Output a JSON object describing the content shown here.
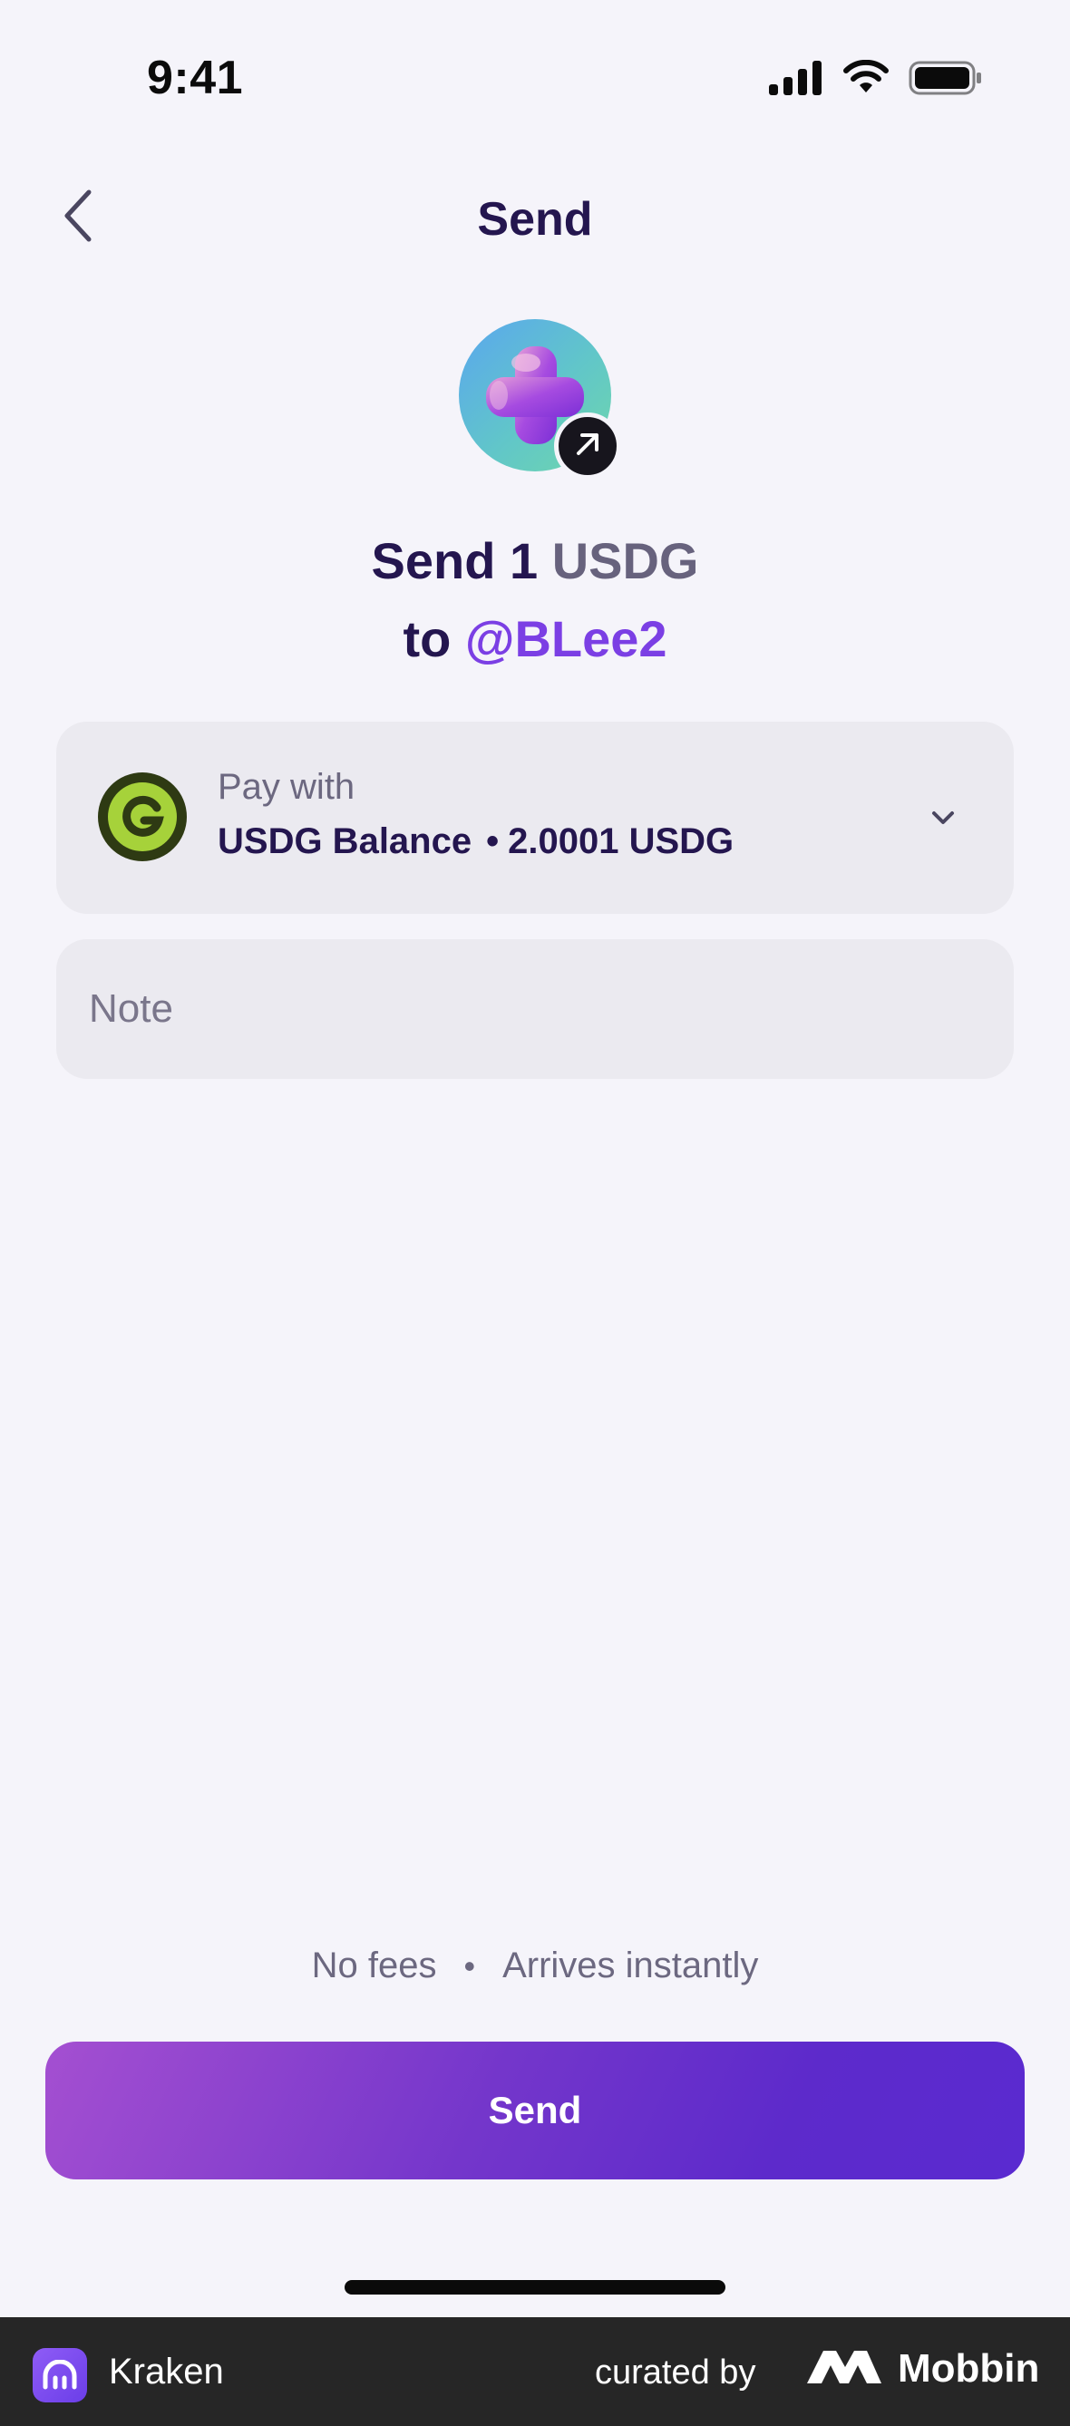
{
  "status_bar": {
    "time": "9:41",
    "icons": [
      "signal-icon",
      "wifi-icon",
      "battery-icon"
    ]
  },
  "header": {
    "title": "Send",
    "back_icon": "chevron-left-icon"
  },
  "recipient": {
    "avatar": "3d-cross-avatar",
    "badge_icon": "arrow-up-right-icon",
    "heading_prefix": "Send 1",
    "heading_asset": "USDG",
    "heading_to": "to",
    "handle": "@BLee2"
  },
  "pay_with": {
    "label": "Pay with",
    "account": "USDG Balance",
    "separator": "•",
    "balance": "2.0001 USDG",
    "icon": "usdg-coin-icon",
    "dropdown_icon": "chevron-down-icon"
  },
  "note": {
    "placeholder": "Note",
    "value": ""
  },
  "info": {
    "fees": "No fees",
    "separator": "•",
    "arrival": "Arrives instantly"
  },
  "actions": {
    "send_label": "Send"
  },
  "footer": {
    "app_name": "Kraken",
    "curated_by": "curated by",
    "brand": "Mobbin"
  },
  "colors": {
    "background": "#f5f4fa",
    "text_primary": "#24164f",
    "accent": "#7b3fe4",
    "button_start": "#a44fd1",
    "button_end": "#5a2ad0",
    "footer_bg": "#262626"
  }
}
